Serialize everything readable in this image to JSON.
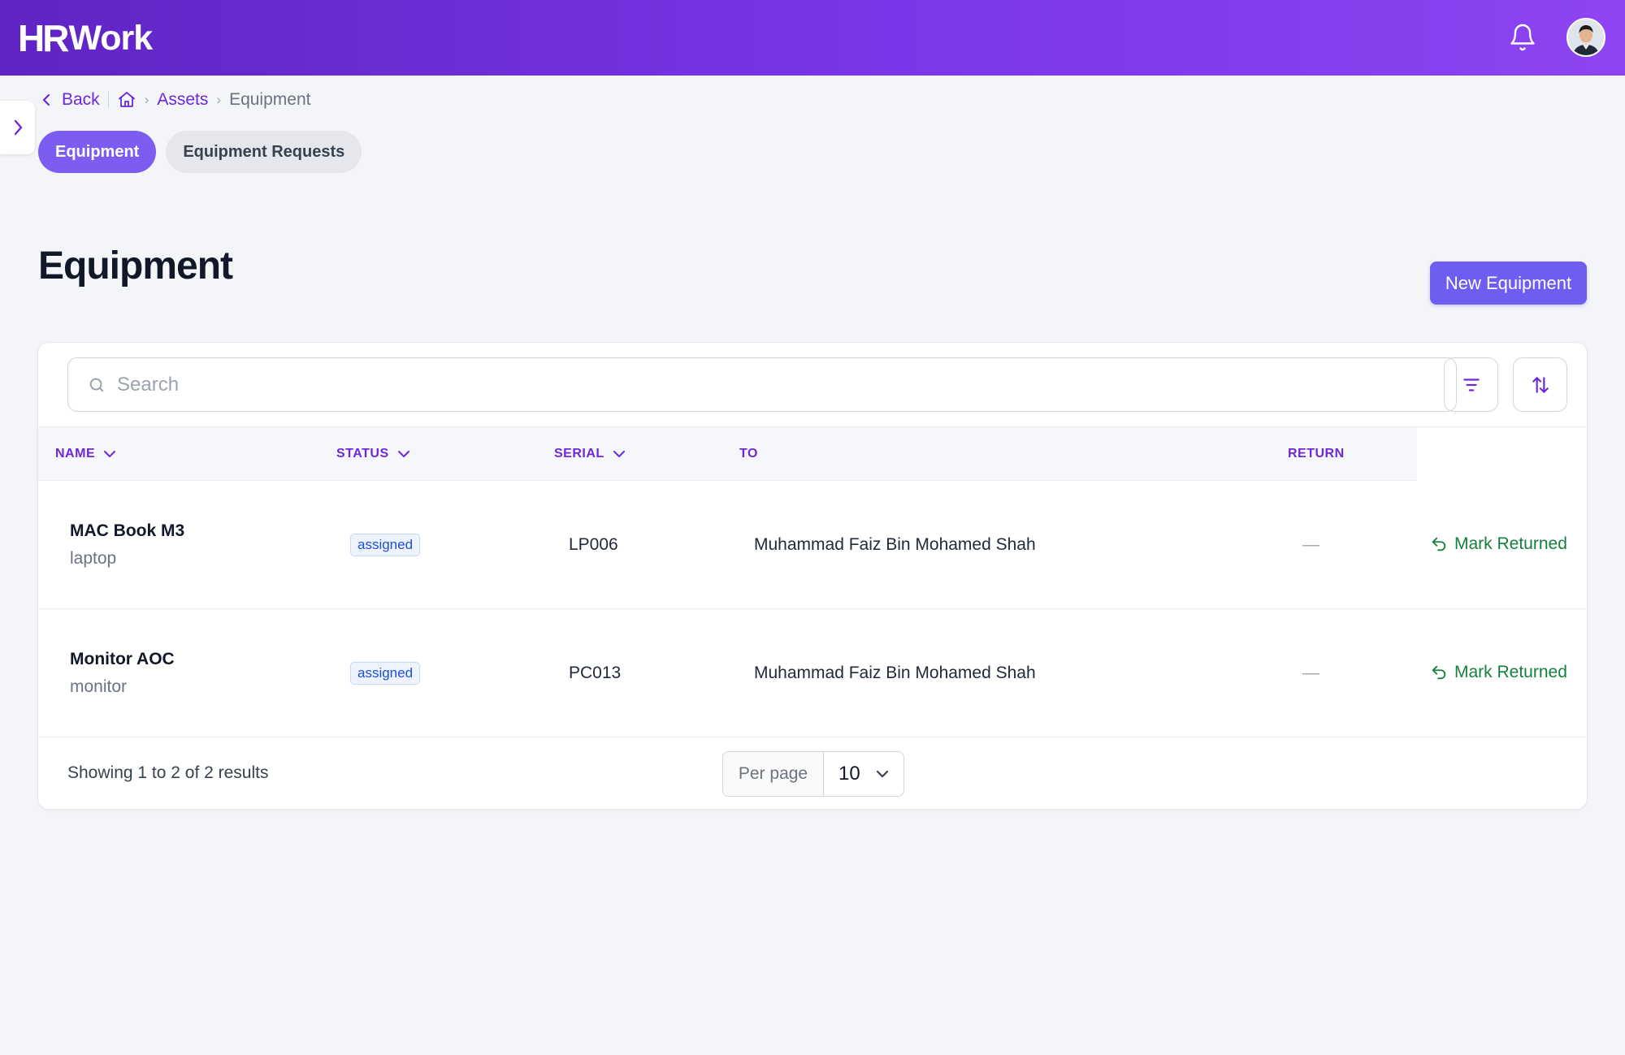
{
  "app": {
    "logo_hr": "HR",
    "logo_work": "Work",
    "colors": {
      "primary": "#6d28d9",
      "button": "#6d5df0",
      "success": "#15803d"
    }
  },
  "header": {
    "notification_icon": "bell-icon",
    "avatar_icon": "user-avatar"
  },
  "breadcrumb": {
    "back": "Back",
    "home_icon": "home-icon",
    "items": [
      "Assets",
      "Equipment"
    ]
  },
  "tabs": [
    {
      "label": "Equipment",
      "active": true
    },
    {
      "label": "Equipment Requests",
      "active": false
    }
  ],
  "page": {
    "title": "Equipment",
    "new_button": "New Equipment"
  },
  "search": {
    "placeholder": "Search",
    "value": ""
  },
  "table": {
    "columns": [
      "NAME",
      "STATUS",
      "SERIAL",
      "TO",
      "RETURN"
    ],
    "rows": [
      {
        "name": "MAC Book M3",
        "type": "laptop",
        "status": "assigned",
        "serial": "LP006",
        "to": "Muhammad Faiz Bin Mohamed Shah",
        "return": "—",
        "action": "Mark Returned"
      },
      {
        "name": "Monitor AOC",
        "type": "monitor",
        "status": "assigned",
        "serial": "PC013",
        "to": "Muhammad Faiz Bin Mohamed Shah",
        "return": "—",
        "action": "Mark Returned"
      }
    ]
  },
  "pagination": {
    "summary": "Showing 1 to 2 of 2 results",
    "per_page_label": "Per page",
    "per_page_value": "10"
  }
}
